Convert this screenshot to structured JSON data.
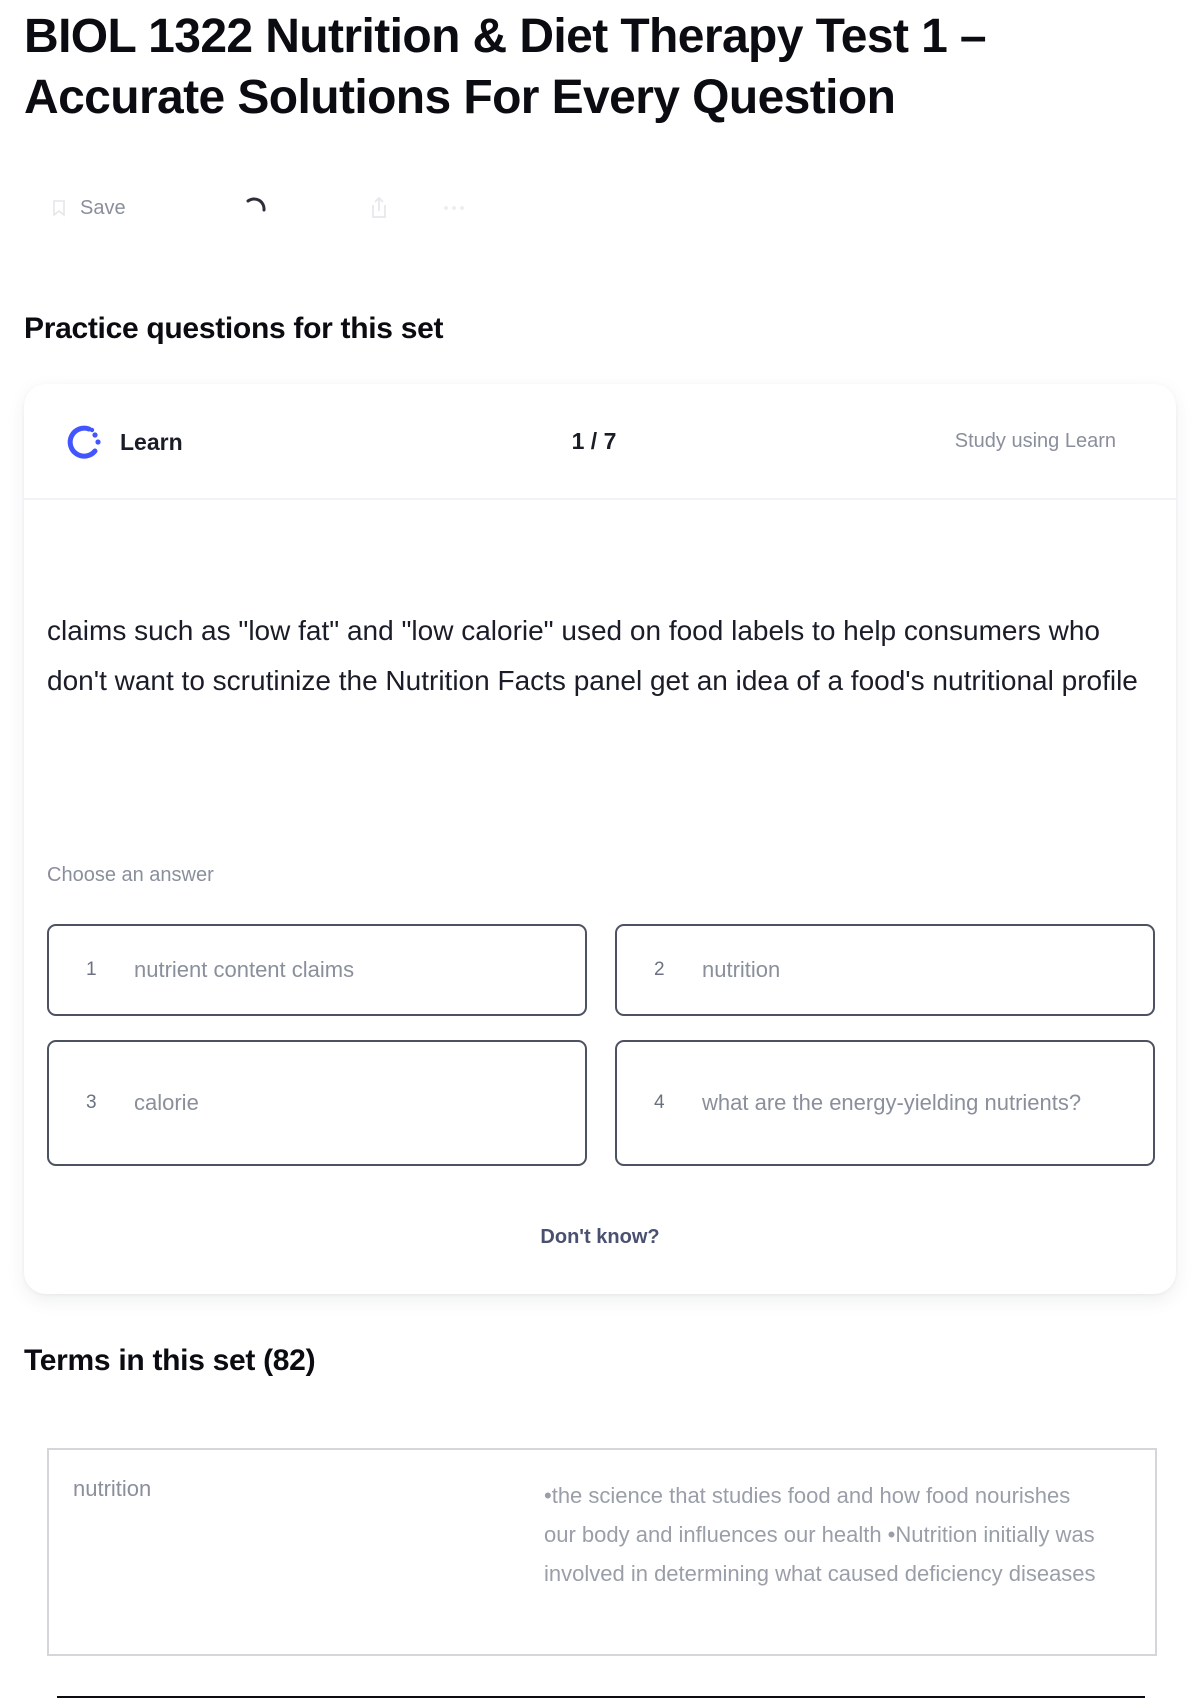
{
  "page": {
    "title": "BIOL 1322 Nutrition & Diet Therapy Test 1 – Accurate Solutions For Every Question"
  },
  "toolbar": {
    "save_label": "Save",
    "icons": [
      "bookmark-icon",
      "loading-spinner-icon",
      "share-icon",
      "more-options-icon"
    ]
  },
  "practice": {
    "heading": "Practice questions for this set",
    "learn_label": "Learn",
    "progress": "1 / 7",
    "study_link": "Study using Learn",
    "question": "claims such as \"low fat\" and \"low calorie\" used on food labels to help consumers who don't want to scrutinize the Nutrition Facts panel get an idea of a food's nutritional profile",
    "choose_label": "Choose an answer",
    "options": [
      {
        "num": "1",
        "text": "nutrient content claims"
      },
      {
        "num": "2",
        "text": "nutrition"
      },
      {
        "num": "3",
        "text": "calorie"
      },
      {
        "num": "4",
        "text": "what are the energy-yielding nutrients?"
      }
    ],
    "dont_know": "Don't know?"
  },
  "terms": {
    "heading": "Terms in this set (82)",
    "items": [
      {
        "term": "nutrition",
        "definition": "•the science that studies food and how food nourishes our body and influences our health •Nutrition initially was involved in determining what caused deficiency diseases"
      }
    ]
  },
  "colors": {
    "text_primary": "#0a0c12",
    "text_muted": "#8a8f9c",
    "learn_accent": "#4255ff",
    "option_border": "#4d5263"
  }
}
